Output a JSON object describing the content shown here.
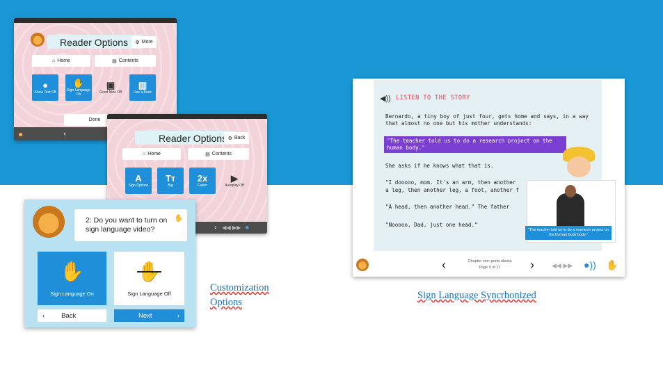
{
  "app": {
    "reader_options_title": "Reader Options",
    "more_label": "More",
    "back_label": "Back",
    "home_label": "Home",
    "contents_label": "Contents",
    "done_label": "Done",
    "tiles_first": [
      "Show Text Off",
      "Sign Language On",
      "Good Nine Off",
      "Use a Book"
    ],
    "tiles_second": [
      {
        "icon": "A",
        "label": "Sign Options"
      },
      {
        "icon": "Tт",
        "label": "Big"
      },
      {
        "icon": "2x",
        "label": "Faster"
      },
      {
        "icon": "▶",
        "label": "Autoplay Off"
      }
    ]
  },
  "wizard": {
    "question": "2: Do you want to turn on sign language video?",
    "option_on": "Sign Language On",
    "option_off": "Sign Language Off",
    "back": "Back",
    "next": "Next"
  },
  "captions": {
    "left": "Customization Options",
    "right": "Sign Language Syncrhonized"
  },
  "reader": {
    "listen_label": "LISTEN TO THE STORY",
    "paragraph1": "Bernardo, a tiny boy of just four, gets home and says, in a way that almost no one but his mother understands:",
    "highlight": "\"The teacher told us to do a research project on the human body.\"",
    "paragraph2": "She asks if he knows what that is.",
    "paragraph3a": "\"I dooooo, mom. It's an arm, then another",
    "paragraph3b": "a leg, then another leg, a foot, another f",
    "paragraph4": "\"A head, then another head.\" The father",
    "paragraph5": "\"Nooooo, Dad, just one head.\"",
    "video_subtitle": "\"The teacher told us to do a research project on the human body body.\"",
    "chapter": "Chapter one: porta aberta",
    "page": "Page 9 of 17"
  },
  "colors": {
    "band": "#1a98d5",
    "tile_blue": "#1e8fd8",
    "highlight_purple": "#7b3fd1",
    "caption_blue": "#1a6fb6"
  }
}
